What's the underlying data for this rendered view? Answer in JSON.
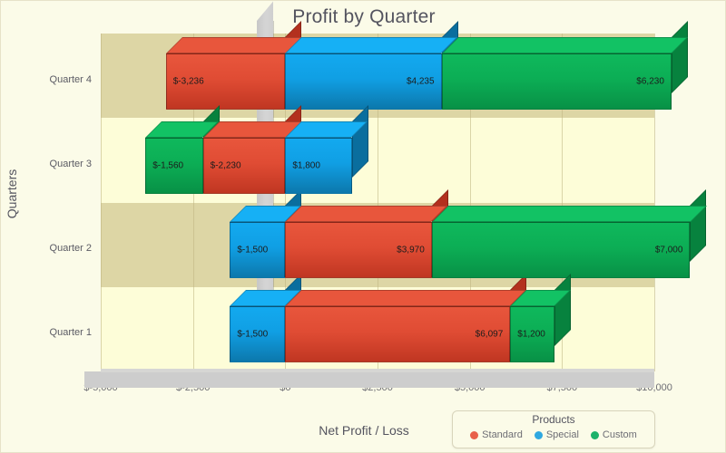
{
  "chart_data": {
    "type": "bar",
    "title": "Profit by Quarter",
    "xlabel": "Net Profit / Loss",
    "ylabel": "Quarters",
    "orientation": "horizontal",
    "stacked": true,
    "three_d": true,
    "grid": true,
    "legend_position": "bottom-right",
    "legend_title": "Products",
    "xlim": [
      -5000,
      10000
    ],
    "xticks": [
      -5000,
      -2500,
      0,
      2500,
      5000,
      7500,
      10000
    ],
    "xtick_labels": [
      "$-5,000",
      "$-2,500",
      "$0",
      "$2,500",
      "$5,000",
      "$7,500",
      "$10,000"
    ],
    "categories": [
      "Quarter 1",
      "Quarter 2",
      "Quarter 3",
      "Quarter 4"
    ],
    "series": [
      {
        "name": "Standard",
        "color": "#e0512f",
        "values": [
          6097,
          3970,
          -2230,
          -3236
        ]
      },
      {
        "name": "Special",
        "color": "#1ba1e2",
        "values": [
          -1500,
          -1500,
          1800,
          4235
        ]
      },
      {
        "name": "Custom",
        "color": "#0eb05a",
        "values": [
          1200,
          7000,
          -1560,
          6230
        ]
      }
    ],
    "bars": [
      {
        "category": "Quarter 4",
        "segments": [
          {
            "series": "Standard",
            "value": -3236,
            "label": "$-3,236",
            "color": "red",
            "start": -3236,
            "end": 0,
            "label_align": "left"
          },
          {
            "series": "Special",
            "value": 4235,
            "label": "$4,235",
            "color": "blue",
            "start": 0,
            "end": 4235,
            "label_align": "right"
          },
          {
            "series": "Custom",
            "value": 6230,
            "label": "$6,230",
            "color": "green",
            "start": 4235,
            "end": 10465,
            "label_align": "right"
          }
        ]
      },
      {
        "category": "Quarter 3",
        "segments": [
          {
            "series": "Custom",
            "value": -1560,
            "label": "$-1,560",
            "color": "green",
            "start": -3790,
            "end": -2230,
            "label_align": "left"
          },
          {
            "series": "Standard",
            "value": -2230,
            "label": "$-2,230",
            "color": "red",
            "start": -2230,
            "end": 0,
            "label_align": "left"
          },
          {
            "series": "Special",
            "value": 1800,
            "label": "$1,800",
            "color": "blue",
            "start": 0,
            "end": 1800,
            "label_align": "left"
          }
        ]
      },
      {
        "category": "Quarter 2",
        "segments": [
          {
            "series": "Special",
            "value": -1500,
            "label": "$-1,500",
            "color": "blue",
            "start": -1500,
            "end": 0,
            "label_align": "left"
          },
          {
            "series": "Standard",
            "value": 3970,
            "label": "$3,970",
            "color": "red",
            "start": 0,
            "end": 3970,
            "label_align": "right"
          },
          {
            "series": "Custom",
            "value": 7000,
            "label": "$7,000",
            "color": "green",
            "start": 3970,
            "end": 10970,
            "label_align": "right"
          }
        ]
      },
      {
        "category": "Quarter 1",
        "segments": [
          {
            "series": "Special",
            "value": -1500,
            "label": "$-1,500",
            "color": "blue",
            "start": -1500,
            "end": 0,
            "label_align": "left"
          },
          {
            "series": "Standard",
            "value": 6097,
            "label": "$6,097",
            "color": "red",
            "start": 0,
            "end": 6097,
            "label_align": "right"
          },
          {
            "series": "Custom",
            "value": 1200,
            "label": "$1,200",
            "color": "green",
            "start": 6097,
            "end": 7297,
            "label_align": "left"
          }
        ]
      }
    ],
    "legend_entries": [
      {
        "label": "Standard",
        "color": "#e8604a"
      },
      {
        "label": "Special",
        "color": "#2fa8e0"
      },
      {
        "label": "Custom",
        "color": "#1cb26a"
      }
    ]
  }
}
